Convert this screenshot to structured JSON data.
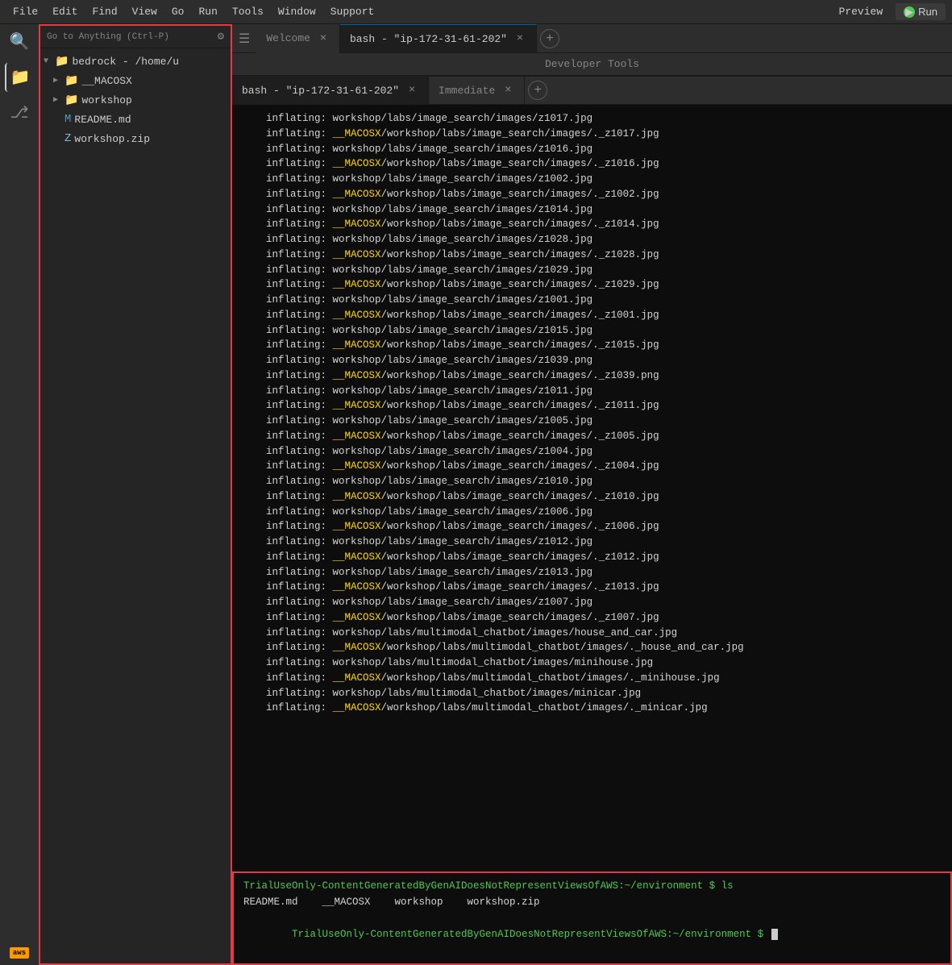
{
  "menubar": {
    "items": [
      "File",
      "Edit",
      "Find",
      "View",
      "Go",
      "Run",
      "Tools",
      "Window",
      "Support"
    ],
    "preview_label": "Preview",
    "run_label": "Run"
  },
  "activitybar": {
    "icons": [
      "search",
      "files",
      "git",
      "aws"
    ]
  },
  "explorer": {
    "search_placeholder": "Go to Anything (Ctrl-P)",
    "root": {
      "label": "bedrock - /home/u",
      "children": [
        {
          "type": "folder",
          "label": "__MACOSX",
          "expanded": false
        },
        {
          "type": "folder",
          "label": "workshop",
          "expanded": false
        },
        {
          "type": "file-md",
          "label": "README.md"
        },
        {
          "type": "file-zip",
          "label": "workshop.zip"
        }
      ]
    }
  },
  "tabs": {
    "welcome": {
      "label": "Welcome",
      "active": false
    },
    "bash": {
      "label": "bash - \"ip-172-31-61-202\"",
      "active": true
    },
    "immediate": {
      "label": "Immediate",
      "active": false
    }
  },
  "devtools_label": "Developer Tools",
  "terminal": {
    "lines": [
      "    inflating: workshop/labs/image_search/images/z1017.jpg",
      "    inflating: __MACOSX/workshop/labs/image_search/images/._z1017.jpg",
      "    inflating: workshop/labs/image_search/images/z1016.jpg",
      "    inflating: __MACOSX/workshop/labs/image_search/images/._z1016.jpg",
      "    inflating: workshop/labs/image_search/images/z1002.jpg",
      "    inflating: __MACOSX/workshop/labs/image_search/images/._z1002.jpg",
      "    inflating: workshop/labs/image_search/images/z1014.jpg",
      "    inflating: __MACOSX/workshop/labs/image_search/images/._z1014.jpg",
      "    inflating: workshop/labs/image_search/images/z1028.jpg",
      "    inflating: __MACOSX/workshop/labs/image_search/images/._z1028.jpg",
      "    inflating: workshop/labs/image_search/images/z1029.jpg",
      "    inflating: __MACOSX/workshop/labs/image_search/images/._z1029.jpg",
      "    inflating: workshop/labs/image_search/images/z1001.jpg",
      "    inflating: __MACOSX/workshop/labs/image_search/images/._z1001.jpg",
      "    inflating: workshop/labs/image_search/images/z1015.jpg",
      "    inflating: __MACOSX/workshop/labs/image_search/images/._z1015.jpg",
      "    inflating: workshop/labs/image_search/images/z1039.png",
      "    inflating: __MACOSX/workshop/labs/image_search/images/._z1039.png",
      "    inflating: workshop/labs/image_search/images/z1011.jpg",
      "    inflating: __MACOSX/workshop/labs/image_search/images/._z1011.jpg",
      "    inflating: workshop/labs/image_search/images/z1005.jpg",
      "    inflating: __MACOSX/workshop/labs/image_search/images/._z1005.jpg",
      "    inflating: workshop/labs/image_search/images/z1004.jpg",
      "    inflating: __MACOSX/workshop/labs/image_search/images/._z1004.jpg",
      "    inflating: workshop/labs/image_search/images/z1010.jpg",
      "    inflating: __MACOSX/workshop/labs/image_search/images/._z1010.jpg",
      "    inflating: workshop/labs/image_search/images/z1006.jpg",
      "    inflating: __MACOSX/workshop/labs/image_search/images/._z1006.jpg",
      "    inflating: workshop/labs/image_search/images/z1012.jpg",
      "    inflating: __MACOSX/workshop/labs/image_search/images/._z1012.jpg",
      "    inflating: workshop/labs/image_search/images/z1013.jpg",
      "    inflating: __MACOSX/workshop/labs/image_search/images/._z1013.jpg",
      "    inflating: workshop/labs/image_search/images/z1007.jpg",
      "    inflating: __MACOSX/workshop/labs/image_search/images/._z1007.jpg",
      "    inflating: workshop/labs/multimodal_chatbot/images/house_and_car.jpg",
      "    inflating: __MACOSX/workshop/labs/multimodal_chatbot/images/._house_and_car.jpg",
      "    inflating: workshop/labs/multimodal_chatbot/images/minihouse.jpg",
      "    inflating: __MACOSX/workshop/labs/multimodal_chatbot/images/._minihouse.jpg",
      "    inflating: workshop/labs/multimodal_chatbot/images/minicar.jpg",
      "    inflating: __MACOSX/workshop/labs/multimodal_chatbot/images/._minicar.jpg"
    ],
    "bottom": {
      "prompt1": "TrialUseOnly-ContentGeneratedByGenAIDoesNotRepresentViewsOfAWS:~/environment $ ls",
      "ls_output": "README.md    __MACOSX    workshop    workshop.zip",
      "prompt2": "TrialUseOnly-ContentGeneratedByGenAIDoesNotRepresentViewsOfAWS:~/environment $ "
    }
  }
}
